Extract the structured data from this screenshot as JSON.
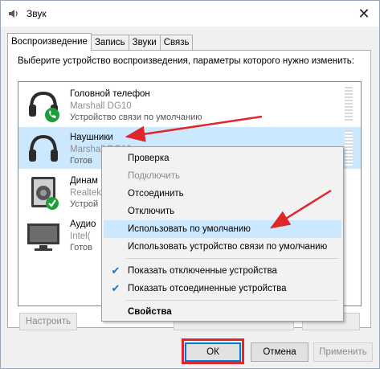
{
  "window": {
    "title": "Звук",
    "close_icon": "close-icon"
  },
  "tabs": [
    {
      "label": "Воспроизведение",
      "active": true
    },
    {
      "label": "Запись",
      "active": false
    },
    {
      "label": "Звуки",
      "active": false
    },
    {
      "label": "Связь",
      "active": false
    }
  ],
  "instruction": "Выберите устройство воспроизведения, параметры которого нужно изменить:",
  "devices": [
    {
      "name": "Головной телефон",
      "sub": "Marshall DG10",
      "status": "Устройство связи по умолчанию",
      "icon": "headset-icon",
      "badge": "phone-badge-icon",
      "selected": false
    },
    {
      "name": "Наушники",
      "sub": "Marshall DG10",
      "status": "Готов",
      "icon": "headphones-icon",
      "selected": true
    },
    {
      "name": "Динам",
      "sub": "Realtek",
      "status": "Устрой",
      "icon": "speaker-icon",
      "badge": "check-badge-icon",
      "selected": false
    },
    {
      "name": "Аудио",
      "sub": "Intel(",
      "status": "Готов",
      "icon": "monitor-icon",
      "selected": false
    }
  ],
  "panel_buttons": {
    "configure": "Настроить"
  },
  "context_menu": {
    "items": [
      {
        "label": "Проверка",
        "disabled": false
      },
      {
        "label": "Подключить",
        "disabled": true
      },
      {
        "label": "Отсоединить",
        "disabled": false
      },
      {
        "label": "Отключить",
        "disabled": false
      },
      {
        "label": "Использовать по умолчанию",
        "disabled": false,
        "highlighted": true
      },
      {
        "label": "Использовать устройство связи по умолчанию",
        "disabled": false
      },
      {
        "label": "Показать отключенные устройства",
        "checked": true
      },
      {
        "label": "Показать отсоединенные устройства",
        "checked": true
      },
      {
        "label": "Свойства",
        "bold": true
      }
    ]
  },
  "dialog_buttons": {
    "ok": "ОК",
    "cancel": "Отмена",
    "apply": "Применить"
  },
  "colors": {
    "selection": "#cce8ff",
    "annotation": "#e0262a",
    "accent": "#0078d7"
  }
}
